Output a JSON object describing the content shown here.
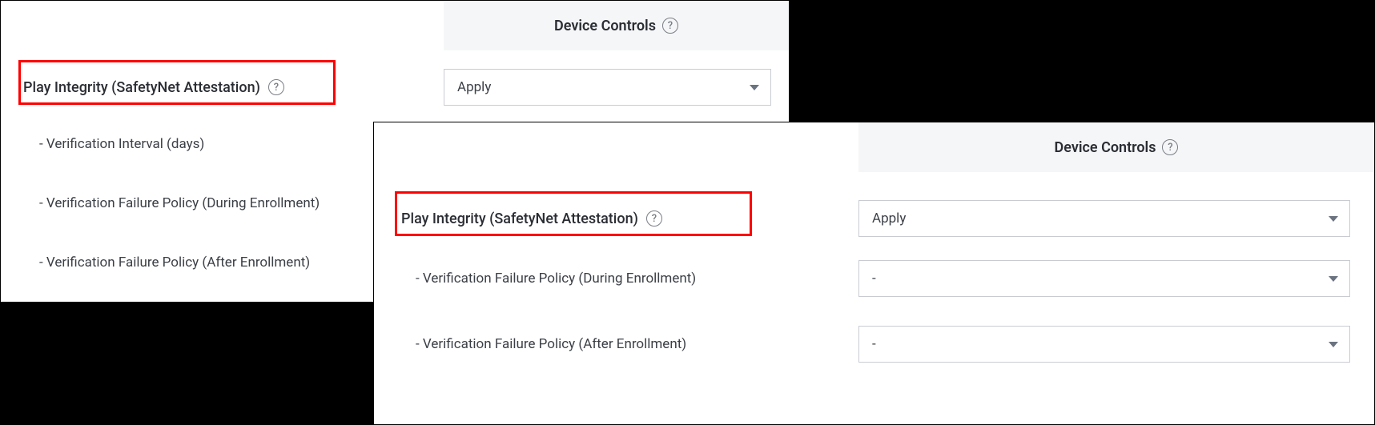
{
  "panel1": {
    "header": "Device Controls",
    "main_label": "Play Integrity (SafetyNet Attestation)",
    "main_dropdown": "Apply",
    "sub_items": [
      {
        "label": "- Verification Interval (days)"
      },
      {
        "label": "- Verification Failure Policy (During Enrollment)"
      },
      {
        "label": "- Verification Failure Policy (After Enrollment)"
      }
    ]
  },
  "panel2": {
    "header": "Device Controls",
    "main_label": "Play Integrity (SafetyNet Attestation)",
    "main_dropdown": "Apply",
    "sub_items": [
      {
        "label": "- Verification Failure Policy (During Enrollment)",
        "value": "-"
      },
      {
        "label": "- Verification Failure Policy (After Enrollment)",
        "value": "-"
      }
    ]
  }
}
